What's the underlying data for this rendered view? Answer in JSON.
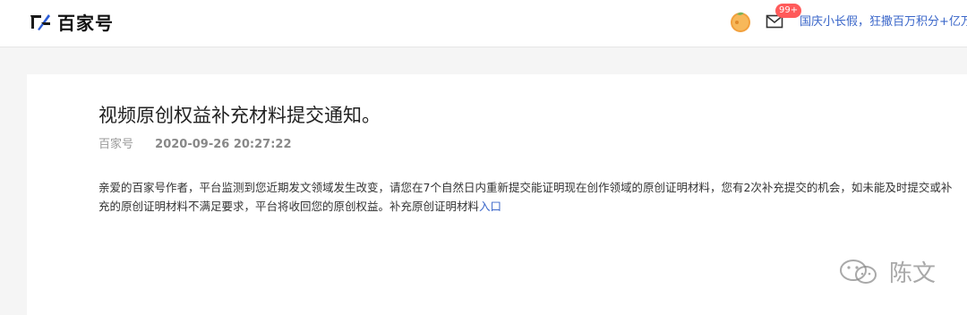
{
  "header": {
    "logo_text": "百家号",
    "badge": "99+",
    "notice_link": "国庆小长假，狂撒百万积分+亿万"
  },
  "article": {
    "title": "视频原创权益补充材料提交通知。",
    "source": "百家号",
    "datetime": "2020-09-26 20:27:22",
    "body_text": "亲爱的百家号作者，平台监测到您近期发文领域发生改变，请您在7个自然日内重新提交能证明现在创作领域的原创证明材料，您有2次补充提交的机会，如未能及时提交或补充的原创证明材料不满足要求，平台将收回您的原创权益。补充原创证明材料",
    "link_text": "入口"
  },
  "watermark": {
    "text": "陈文"
  },
  "colors": {
    "link": "#3a66c9",
    "badge": "#ff5a5a"
  },
  "icons": {
    "logo": "baijiahao-logo-icon",
    "avatar": "orange-avatar-icon",
    "mail": "mail-icon",
    "watermark": "wechat-icon"
  }
}
